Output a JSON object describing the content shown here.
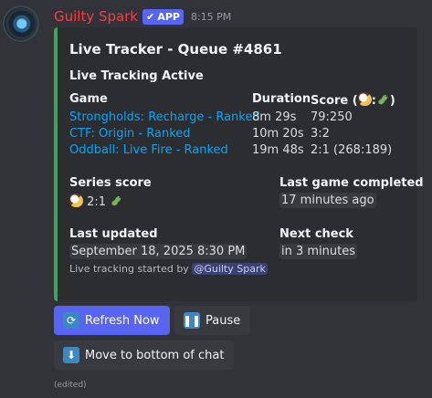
{
  "message": {
    "username": "Guilty Spark",
    "badge": "APP",
    "time": "8:15 PM",
    "edited": "(edited)"
  },
  "embed": {
    "title": "Live Tracker - Queue #4861",
    "description": "Live Tracking Active",
    "table": {
      "headers": {
        "game": "Game",
        "duration": "Duration",
        "score": "Score ("
      },
      "rows": [
        {
          "game": "Strongholds: Recharge - Ranked",
          "duration": "8m 29s",
          "score": "79:250"
        },
        {
          "game": "CTF: Origin - Ranked",
          "duration": "10m 20s",
          "score": "3:2"
        },
        {
          "game": "Oddball: Live Fire - Ranked",
          "duration": "19m 48s",
          "score": "2:1 (268:189)"
        }
      ]
    },
    "fields": {
      "series_score_label": "Series score",
      "series_score_value": "2:1",
      "last_game_label": "Last game completed",
      "last_game_value": "17 minutes ago",
      "last_updated_label": "Last updated",
      "last_updated_value": "September 18, 2025 8:30 PM",
      "next_check_label": "Next check",
      "next_check_value": "in 3 minutes"
    },
    "footer": {
      "prefix": "Live tracking started by",
      "mention": "@Guilty Spark"
    },
    "accent_color": "#3ba55d"
  },
  "buttons": {
    "refresh": "Refresh Now",
    "pause": "Pause",
    "move_bottom": "Move to bottom of chat"
  }
}
